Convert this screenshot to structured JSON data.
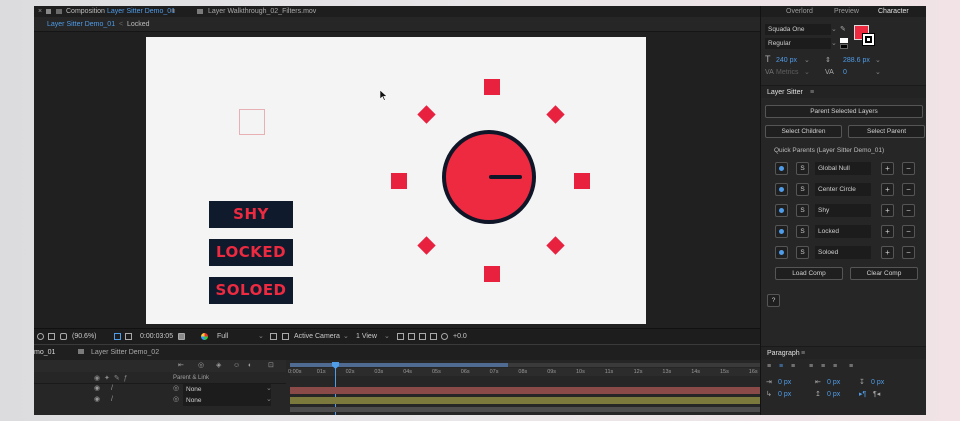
{
  "header": {
    "comp_prefix": "Composition",
    "comp_name": "Layer Sitter Demo_01",
    "footage_label": "Layer Walkthrough_02_Filters.mov",
    "breadcrumb_comp": "Layer Sitter Demo_01",
    "breadcrumb_locked": "Locked"
  },
  "canvas": {
    "labels": [
      "SHY",
      "LOCKED",
      "SOLOED"
    ],
    "accent": "#ee2a41",
    "navy": "#0f1628",
    "background": "#f4f4f5"
  },
  "viewer_toolbar": {
    "zoom": "(90.6%)",
    "timecode": "0:00:03:05",
    "resolution": "Full",
    "camera": "Active Camera",
    "views": "1 View",
    "exposure": "+0.0"
  },
  "timeline": {
    "tab_left": "mo_01",
    "tab_right": "Layer Sitter Demo_02",
    "parent_header": "Parent & Link",
    "rows": [
      {
        "parent": "None"
      },
      {
        "parent": "None"
      }
    ],
    "ticks": [
      "0:00s",
      "01s",
      "02s",
      "03s",
      "04s",
      "05s",
      "06s",
      "07s",
      "08s",
      "09s",
      "10s",
      "11s",
      "12s",
      "13s",
      "14s",
      "15s",
      "16s"
    ]
  },
  "right_panel": {
    "tabs": [
      "Overlord",
      "Preview",
      "Character"
    ],
    "character": {
      "font_family": "Squada One",
      "font_style": "Regular",
      "font_size": "240 px",
      "leading": "288.6 px",
      "kerning": "Metrics",
      "tracking": "0",
      "color": "#ee2a41"
    },
    "layer_sitter": {
      "title": "Layer Sitter",
      "parent_selected": "Parent Selected Layers",
      "select_children": "Select Children",
      "select_parent": "Select Parent",
      "quick_parents_label": "Quick Parents (Layer Sitter Demo_01)",
      "quick_parents": [
        {
          "s": "S",
          "name": "Global Null"
        },
        {
          "s": "S",
          "name": "Center Circle"
        },
        {
          "s": "S",
          "name": "Shy"
        },
        {
          "s": "S",
          "name": "Locked"
        },
        {
          "s": "S",
          "name": "Soloed"
        }
      ],
      "plus": "+",
      "minus": "−",
      "load_comp": "Load Comp",
      "clear_comp": "Clear Comp",
      "help": "?"
    },
    "paragraph": {
      "title": "Paragraph",
      "indent_values": [
        "0 px",
        "0 px",
        "0 px",
        "0 px",
        "0 px"
      ]
    }
  }
}
